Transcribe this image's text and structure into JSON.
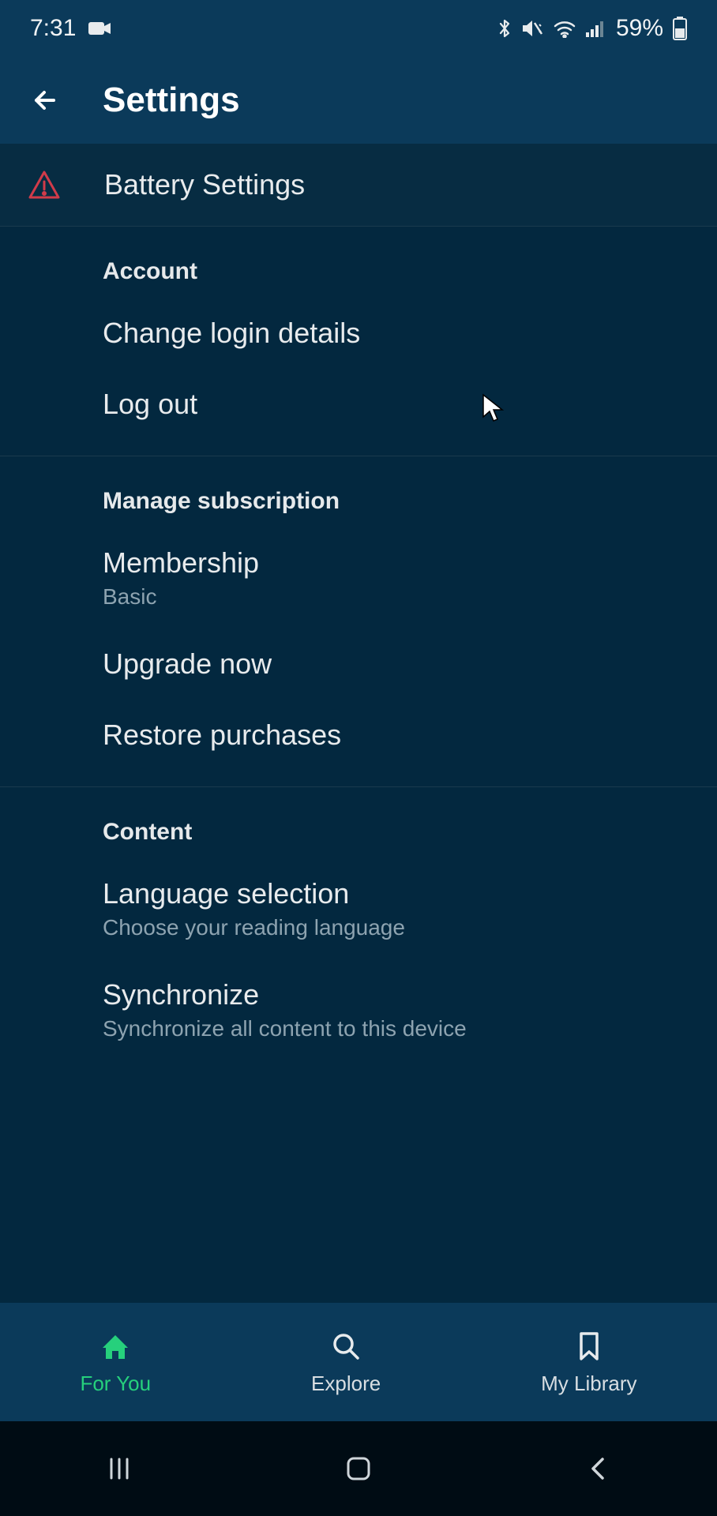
{
  "status": {
    "time": "7:31",
    "battery_text": "59%"
  },
  "header": {
    "title": "Settings"
  },
  "alert": {
    "label": "Battery Settings"
  },
  "sections": {
    "account": {
      "title": "Account",
      "change_login": "Change login details",
      "log_out": "Log out"
    },
    "subscription": {
      "title": "Manage subscription",
      "membership_label": "Membership",
      "membership_value": "Basic",
      "upgrade": "Upgrade now",
      "restore": "Restore purchases"
    },
    "content": {
      "title": "Content",
      "language_label": "Language selection",
      "language_sub": "Choose your reading language",
      "sync_label": "Synchronize",
      "sync_sub": "Synchronize all content to this device"
    }
  },
  "tabs": {
    "for_you": "For You",
    "explore": "Explore",
    "my_library": "My Library"
  }
}
